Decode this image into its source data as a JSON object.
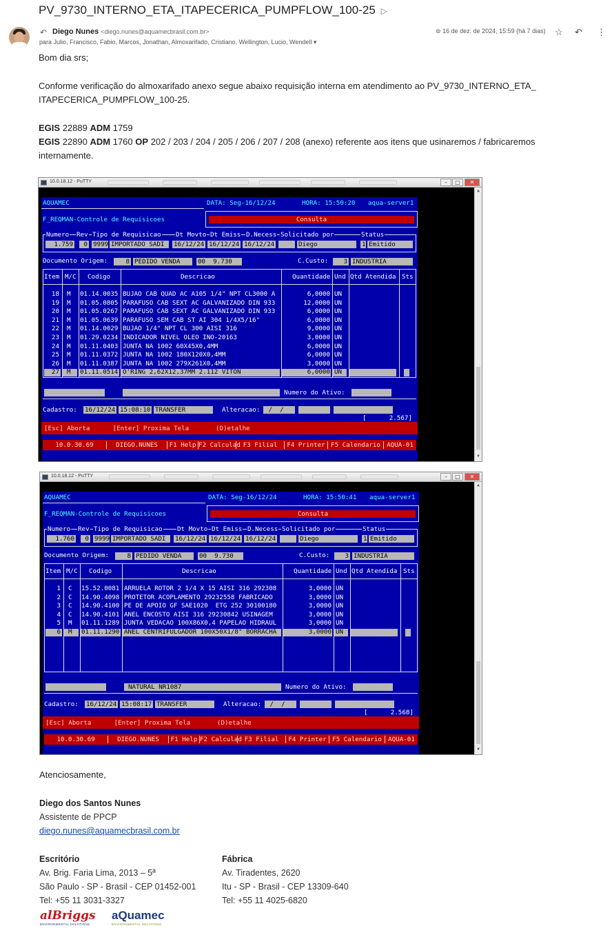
{
  "email": {
    "subject": "PV_9730_INTERNO_ETA_ITAPECERICA_PUMPFLOW_100-25",
    "sender_name": "Diego Nunes",
    "sender_email": "<diego.nunes@aquamecbrasil.com.br>",
    "recipients": "para Julio, Francisco, Fabio, Marcos, Jonathan, Almoxarifado, Cristiano, Wellington, Lucio, Wendell",
    "date": "16 de dez. de 2024, 15:59 (há 7 dias)",
    "greeting": "Bom dia srs;",
    "para1": "Conforme verificação do almoxarifado anexo segue abaixo requisição interna em atendimento ao PV_9730_INTERNO_ETA_",
    "para1b": "ITAPECERICA_PUMPFLOW_100-25.",
    "egis_label": "EGIS",
    "adm_label": "ADM",
    "op_label": "OP",
    "line1_egis": "22889",
    "line1_adm": "1759",
    "line2_egis": "22890",
    "line2_adm": "1760",
    "line2_op": "202 / 203 / 204 / 205 / 206 / 207 / 208 (anexo) referente aos itens que usinaremos / fabricaremos",
    "line2_cont": "internamente.",
    "closing": "Atenciosamente,"
  },
  "signature": {
    "name": "Diego dos Santos Nunes",
    "role": "Assistente de PPCP",
    "email": "diego.nunes@aquamecbrasil.com.br",
    "office_title": "Escritório",
    "office_lines": [
      "Av. Brig. Faria Lima, 2013 – 5ª",
      "São Paulo - SP - Brasil - CEP 01452-001",
      "Tel: +55 11 3031-3327"
    ],
    "factory_title": "Fábrica",
    "factory_lines": [
      "Av. Tiradentes, 2620",
      "Itu - SP - Brasil - CEP 13309-640",
      "Tel: +55 11 4025-6820"
    ],
    "logo1": "alBriggs",
    "logo1_sub": "ENVIRONMENTAL SOLUTIONS",
    "logo2": "aQuamec",
    "logo2_sub": "ENVIRONMENTAL SOLUTIONS"
  },
  "colors": {
    "terminal_blue": "#0000aa",
    "terminal_red": "#c00000",
    "link": "#1a4aa0"
  },
  "screens": [
    {
      "window_title": "10.0.18.12 - PuTTY",
      "app": "AQUAMEC",
      "data": "DATA: Seg-16/12/24",
      "hora": "HORA: 15:50:20",
      "server": "aqua-server1",
      "module": "F_REQMAN-Controle de Requisicoes",
      "mode": "Consulta",
      "hdr_labels": [
        "Numero",
        "Rev",
        "Tipo de Requisicao",
        "Dt Movto",
        "Dt Emiss",
        "D.Necess",
        "Solicitado por",
        "Status"
      ],
      "numero": "1.759",
      "rev": "0",
      "tipo_cod": "9999",
      "tipo": "IMPORTADO SADI",
      "dt_movto": "16/12/24",
      "dt_emiss": "16/12/24",
      "d_necess": "16/12/24",
      "solicitado": "Diego",
      "status_cod": "1",
      "status": "Emitido",
      "doc_label": "Documento Origem:",
      "doc_cod": "8",
      "doc": "PEDIDO VENDA",
      "doc_num": "00  9.730",
      "ccusto_label": "C.Custo:",
      "ccusto_cod": "3",
      "ccusto": "INDUSTRIA",
      "col_headers": [
        "Item",
        "M/C",
        "Codigo",
        "Descricao",
        "Quantidade",
        "Und",
        "Qtd Atendida",
        "Sts"
      ],
      "rows": [
        {
          "item": "18",
          "mc": "M",
          "codigo": "01.14.0035",
          "desc": "BUJAO CAB QUAD AC A105 1/4\" NPT CL3000 A",
          "qtd": "6,0000",
          "und": "UN"
        },
        {
          "item": "19",
          "mc": "M",
          "codigo": "01.05.0805",
          "desc": "PARAFUSO CAB SEXT AC GALVANIZADO DIN 933",
          "qtd": "12,0000",
          "und": "UN"
        },
        {
          "item": "20",
          "mc": "M",
          "codigo": "01.05.0267",
          "desc": "PARAFUSO CAB SEXT AC GALVANIZADO DIN 933",
          "qtd": "6,0000",
          "und": "UN"
        },
        {
          "item": "21",
          "mc": "M",
          "codigo": "01.05.0639",
          "desc": "PARAFUSO SEM CAB ST AI 304 1/4X5/16\"",
          "qtd": "6,0000",
          "und": "UN"
        },
        {
          "item": "22",
          "mc": "M",
          "codigo": "01.14.0029",
          "desc": "BUJAO 1/4\" NPT CL 300 AISI 316",
          "qtd": "9,0000",
          "und": "UN"
        },
        {
          "item": "23",
          "mc": "M",
          "codigo": "01.29.0234",
          "desc": "INDICADOR NIVEL OLEO INO-20163",
          "qtd": "3,0000",
          "und": "UN"
        },
        {
          "item": "24",
          "mc": "M",
          "codigo": "01.11.0403",
          "desc": "JUNTA NA 1002 60X45X0,4MM",
          "qtd": "6,0000",
          "und": "UN"
        },
        {
          "item": "25",
          "mc": "M",
          "codigo": "01.11.0372",
          "desc": "JUNTA NA 1002 180X120X0,4MM",
          "qtd": "6,0000",
          "und": "UN"
        },
        {
          "item": "26",
          "mc": "M",
          "codigo": "01.11.0387",
          "desc": "JUNTA NA 1002 279X261X0,4MM",
          "qtd": "3,0000",
          "und": "UN"
        },
        {
          "item": "27",
          "mc": "M",
          "codigo": "01.11.0514",
          "desc": "O'RING 2,62X12,37MM 2.112 VITON",
          "qtd": "6,0000",
          "und": "UN"
        }
      ],
      "extra_field": "",
      "ativo_label": "Numero do Ativo:",
      "cadastro_label": "Cadastro:",
      "cad_date": "16/12/24",
      "cad_time": "15:08:10",
      "cad_user": "TRANSFER",
      "alteracao_label": "Alteracao:",
      "alt_date": " /  /",
      "counter": "[      2.567]",
      "help": "[Esc] Aborta      [Enter] Proxima Tela       (D)etalhe",
      "fkeys": [
        "10.0.30.69",
        "DIEGO.NUNES",
        "F1 Help",
        "F2 Calculad",
        "F3 Filial",
        "F4 Printer",
        "F5 Calendario",
        "AQUA-01"
      ]
    },
    {
      "window_title": "10.0.18.12 - PuTTY",
      "app": "AQUAMEC",
      "data": "DATA: Seg-16/12/24",
      "hora": "HORA: 15:50:41",
      "server": "aqua-server1",
      "module": "F_REQMAN-Controle de Requisicoes",
      "mode": "Consulta",
      "hdr_labels": [
        "Numero",
        "Rev",
        "Tipo de Requisicao",
        "Dt Movto",
        "Dt Emiss",
        "D.Necess",
        "Solicitado por",
        "Status"
      ],
      "numero": "1.760",
      "rev": "0",
      "tipo_cod": "9999",
      "tipo": "IMPORTADO SADI",
      "dt_movto": "16/12/24",
      "dt_emiss": "16/12/24",
      "d_necess": "16/12/24",
      "solicitado": "Diego",
      "status_cod": "1",
      "status": "Emitido",
      "doc_label": "Documento Origem:",
      "doc_cod": "8",
      "doc": "PEDIDO VENDA",
      "doc_num": "00  9.730",
      "ccusto_label": "C.Custo:",
      "ccusto_cod": "3",
      "ccusto": "INDUSTRIA",
      "col_headers": [
        "Item",
        "M/C",
        "Codigo",
        "Descricao",
        "Quantidade",
        "Und",
        "Qtd Atendida",
        "Sts"
      ],
      "rows": [
        {
          "item": "1",
          "mc": "C",
          "codigo": "15.52.0081",
          "desc": "ARRUELA ROTOR 2 1/4 X 15 AISI 316 292308",
          "qtd": "3,0000",
          "und": "UN"
        },
        {
          "item": "2",
          "mc": "C",
          "codigo": "14.90.4098",
          "desc": "PROTETOR ACOPLAMENTO 29232558 FABRICADO",
          "qtd": "3,0000",
          "und": "UN"
        },
        {
          "item": "3",
          "mc": "C",
          "codigo": "14.90.4100",
          "desc": "PE DE APOIO GF SAE1020  ETG 252 30100180",
          "qtd": "3,0000",
          "und": "UN"
        },
        {
          "item": "4",
          "mc": "C",
          "codigo": "14.90.4101",
          "desc": "ANEL ENCOSTO AISI 316 29230842 USINAGEM",
          "qtd": "3,0000",
          "und": "UN"
        },
        {
          "item": "5",
          "mc": "M",
          "codigo": "01.11.1289",
          "desc": "JUNTA VEDACAO 100X86X0,4 PAPELAO HIDRAUL",
          "qtd": "3,0000",
          "und": "UN"
        },
        {
          "item": "6",
          "mc": "M",
          "codigo": "01.11.1290",
          "desc": "ANEL CENTRIFULGADOR 100X50X1/8\" BORRACHA",
          "qtd": "3,0000",
          "und": "UN"
        }
      ],
      "extra_field": "NATURAL NR1087",
      "ativo_label": "Numero do Ativo:",
      "cadastro_label": "Cadastro:",
      "cad_date": "16/12/24",
      "cad_time": "15:08:17",
      "cad_user": "TRANSFER",
      "alteracao_label": "Alteracao:",
      "alt_date": " /  /",
      "counter": "[      2.568]",
      "help": "[Esc] Aborta      [Enter] Proxima Tela       (D)etalhe",
      "fkeys": [
        "10.0.30.69",
        "DIEGO.NUNES",
        "F1 Help",
        "F2 Calculad",
        "F3 Filial",
        "F4 Printer",
        "F5 Calendario",
        "AQUA-01"
      ]
    }
  ]
}
